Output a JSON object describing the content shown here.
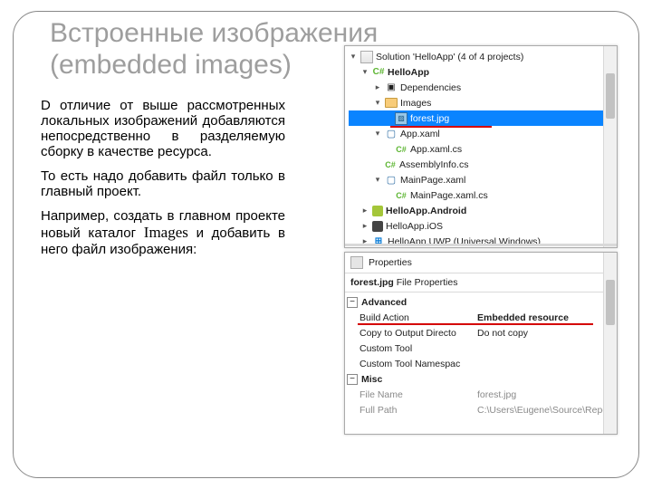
{
  "title": "Встроенные изображения (embedded images)",
  "para1": "D отличие от выше рассмотренных локальных изображений добавляются непосредственно в разделяемую сборку в качестве ресурса.",
  "para2": "То есть надо добавить файл только в главный проект.",
  "para3_a": "Например, создать в главном проекте новый каталог ",
  "para3_b": "Images",
  "para3_c": " и добавить в него файл изображения:",
  "solution": {
    "root": "Solution 'HelloApp' (4 of 4 projects)",
    "items": {
      "helloapp": "HelloApp",
      "deps": "Dependencies",
      "images_folder": "Images",
      "forest": "forest.jpg",
      "appxaml": "App.xaml",
      "appxamlcs": "App.xaml.cs",
      "assembly": "AssemblyInfo.cs",
      "mainpage": "MainPage.xaml",
      "mainpagecs": "MainPage.xaml.cs",
      "android": "HelloApp.Android",
      "ios": "HelloApp.iOS",
      "uwp": "HelloApp.UWP (Universal Windows)"
    }
  },
  "properties": {
    "header_label": "Properties",
    "file_label": "forest.jpg",
    "file_sub": "File Properties",
    "cat_advanced": "Advanced",
    "cat_misc": "Misc",
    "rows": {
      "build_action_k": "Build Action",
      "build_action_v": "Embedded resource",
      "copy_k": "Copy to Output Directo",
      "copy_v": "Do not copy",
      "tool_k": "Custom Tool",
      "toolns_k": "Custom Tool Namespac",
      "filename_k": "File Name",
      "filename_v": "forest.jpg",
      "fullpath_k": "Full Path",
      "fullpath_v": "C:\\Users\\Eugene\\Source\\Repo"
    }
  }
}
